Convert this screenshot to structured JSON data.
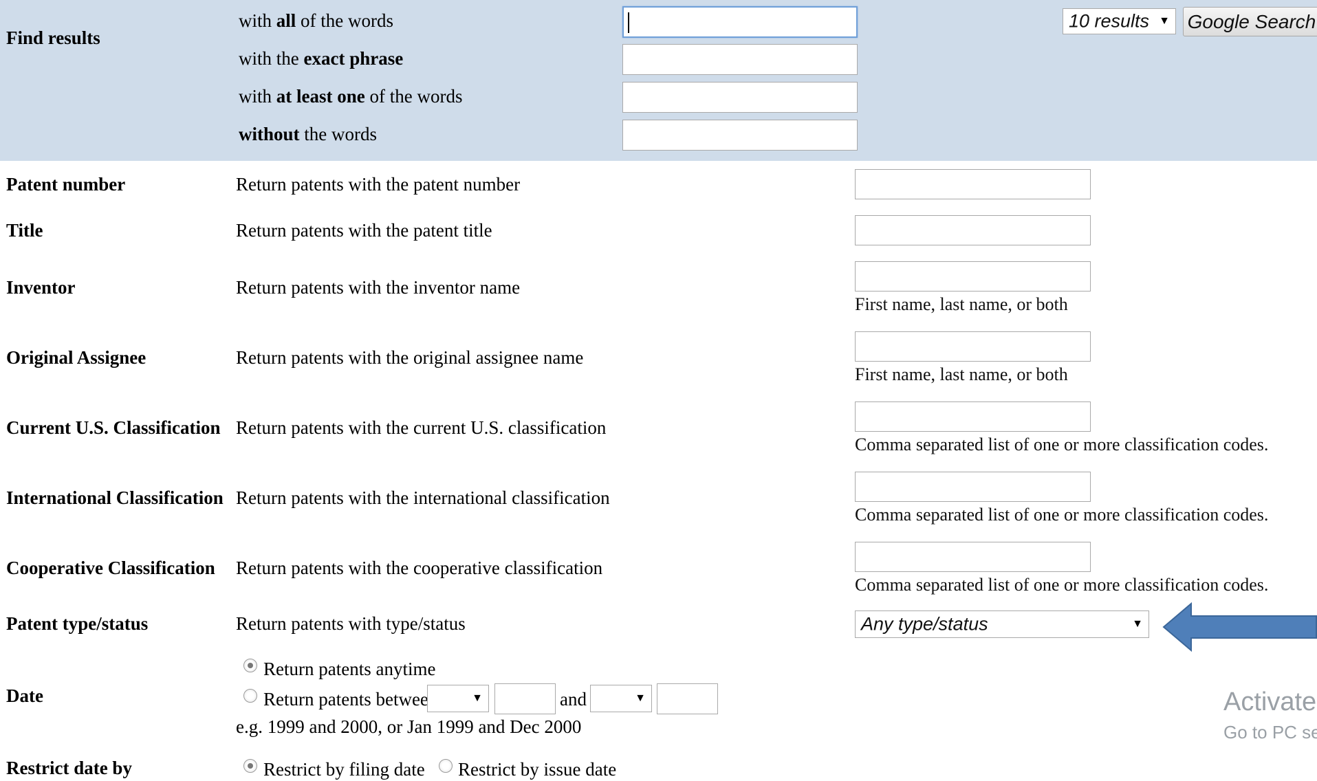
{
  "find_results": {
    "label": "Find results",
    "rows": [
      {
        "prefix": "with ",
        "bold": "all",
        "suffix": " of the words"
      },
      {
        "prefix": "with the ",
        "bold": "exact phrase",
        "suffix": ""
      },
      {
        "prefix": "with ",
        "bold": "at least one",
        "suffix": " of the words"
      },
      {
        "prefix": "",
        "bold": "without",
        "suffix": " the words"
      }
    ],
    "results_select": "10 results",
    "search_button": "Google Search"
  },
  "fields": [
    {
      "label": "Patent number",
      "description": "Return patents with the patent number",
      "hint": ""
    },
    {
      "label": "Title",
      "description": "Return patents with the patent title",
      "hint": ""
    },
    {
      "label": "Inventor",
      "description": "Return patents with the inventor name",
      "hint": "First name, last name, or both"
    },
    {
      "label": "Original Assignee",
      "description": "Return patents with the original assignee name",
      "hint": "First name, last name, or both"
    },
    {
      "label": "Current U.S. Classification",
      "description": "Return patents with the current U.S. classification",
      "hint": "Comma separated list of one or more classification codes."
    },
    {
      "label": "International Classification",
      "description": "Return patents with the international classification",
      "hint": "Comma separated list of one or more classification codes."
    },
    {
      "label": "Cooperative Classification",
      "description": "Return patents with the cooperative classification",
      "hint": "Comma separated list of one or more classification codes."
    }
  ],
  "type_status": {
    "label": "Patent type/status",
    "description": "Return patents with type/status",
    "select_value": "Any type/status"
  },
  "date": {
    "label": "Date",
    "option_anytime": "Return patents anytime",
    "option_between": "Return patents between",
    "and_label": "and",
    "example": "e.g. 1999 and 2000, or Jan 1999 and Dec 2000"
  },
  "restrict": {
    "label": "Restrict date by",
    "option_filing": "Restrict by filing date",
    "option_issue": "Restrict by issue date"
  },
  "watermark": {
    "line1": "Activate W",
    "line2": "Go to PC set"
  },
  "colors": {
    "band": "#cfdcea",
    "arrow": "#4f7fb9"
  }
}
